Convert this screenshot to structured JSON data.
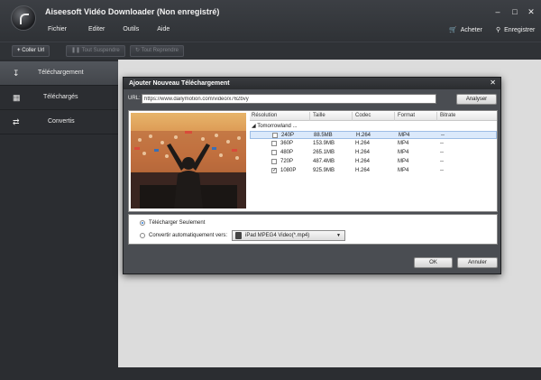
{
  "app": {
    "title": "Aiseesoft Vidéo Downloader (Non enregistré)"
  },
  "menu": [
    "Fichier",
    "Editer",
    "Outils",
    "Aide"
  ],
  "topright": {
    "buy": "Acheter",
    "register": "Enregistrer"
  },
  "toolbar": {
    "paste": "Coller Url",
    "pause_all": "Tout Suspendre",
    "resume_all": "Tout Reprendre"
  },
  "sidebar": {
    "items": [
      {
        "label": "Téléchargement",
        "icon": "download-icon",
        "active": true
      },
      {
        "label": "Téléchargés",
        "icon": "film-icon",
        "active": false
      },
      {
        "label": "Convertis",
        "icon": "convert-icon",
        "active": false
      }
    ]
  },
  "dialog": {
    "title": "Ajouter Nouveau Téléchargement",
    "url_label": "URL:",
    "url_value": "https://www.dailymotion.com/video/x762bvy",
    "analyze": "Analyser",
    "columns": [
      "Résolution",
      "Taille",
      "Codec",
      "Format",
      "Bitrate"
    ],
    "group": "Tomorrowland ...",
    "rows": [
      {
        "res": "240P",
        "size": "88.5MB",
        "codec": "H.264",
        "format": "MP4",
        "bitrate": "--",
        "checked": false,
        "selected": true
      },
      {
        "res": "360P",
        "size": "153.9MB",
        "codec": "H.264",
        "format": "MP4",
        "bitrate": "--",
        "checked": false,
        "selected": false
      },
      {
        "res": "480P",
        "size": "265.1MB",
        "codec": "H.264",
        "format": "MP4",
        "bitrate": "--",
        "checked": false,
        "selected": false
      },
      {
        "res": "720P",
        "size": "487.4MB",
        "codec": "H.264",
        "format": "MP4",
        "bitrate": "--",
        "checked": false,
        "selected": false
      },
      {
        "res": "1080P",
        "size": "925.9MB",
        "codec": "H.264",
        "format": "MP4",
        "bitrate": "--",
        "checked": true,
        "selected": false
      }
    ],
    "option_download_only": "Télécharger Seulement",
    "option_convert": "Convertir automatiquement vers:",
    "format_value": "iPad MPEG4 Video(*.mp4)",
    "ok": "OK",
    "cancel": "Annuler"
  }
}
